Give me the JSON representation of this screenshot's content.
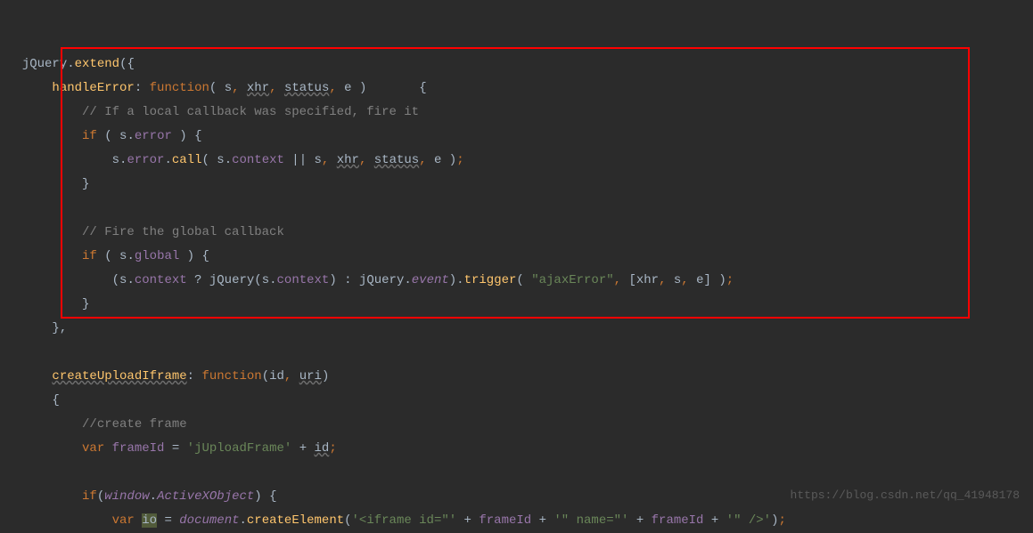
{
  "code": {
    "line1_jquery": "jQuery",
    "line1_extend": "extend",
    "line2_handleError": "handleError",
    "line2_function": "function",
    "line2_s": "s",
    "line2_xhr": "xhr",
    "line2_status": "status",
    "line2_e": "e",
    "line3_comment": "// If a local callback was specified, fire it",
    "line4_if": "if",
    "line4_s": "s",
    "line4_error": "error",
    "line5_s": "s",
    "line5_error": "error",
    "line5_call": "call",
    "line5_s2": "s",
    "line5_context": "context",
    "line5_s3": "s",
    "line5_xhr": "xhr",
    "line5_status": "status",
    "line5_e": "e",
    "line6_close": "}",
    "line8_comment": "// Fire the global callback",
    "line9_if": "if",
    "line9_s": "s",
    "line9_global": "global",
    "line10_s": "s",
    "line10_context": "context",
    "line10_jquery": "jQuery",
    "line10_s2": "s",
    "line10_context2": "context",
    "line10_jquery2": "jQuery",
    "line10_event": "event",
    "line10_trigger": "trigger",
    "line10_ajaxError": "\"ajaxError\"",
    "line10_xhr": "xhr",
    "line10_s3": "s",
    "line10_e": "e",
    "line11_close": "}",
    "line12_close": "},",
    "line14_createUploadIframe": "createUploadIframe",
    "line14_function": "function",
    "line14_id": "id",
    "line14_uri": "uri",
    "line15_open": "{",
    "line16_comment": "//create frame",
    "line17_var": "var",
    "line17_frameId": "frameId",
    "line17_string": "'jUploadFrame'",
    "line17_id": "id",
    "line19_if": "if",
    "line19_window": "window",
    "line19_activex": "ActiveXObject",
    "line20_var": "var",
    "line20_io": "io",
    "line20_document": "document",
    "line20_createElement": "createElement",
    "line20_string1": "'<iframe id=\"'",
    "line20_frameId": "frameId",
    "line20_string2": "'\" name=\"'",
    "line20_frameId2": "frameId",
    "line20_string3": "'\" />'"
  },
  "watermark": "https://blog.csdn.net/qq_41948178"
}
